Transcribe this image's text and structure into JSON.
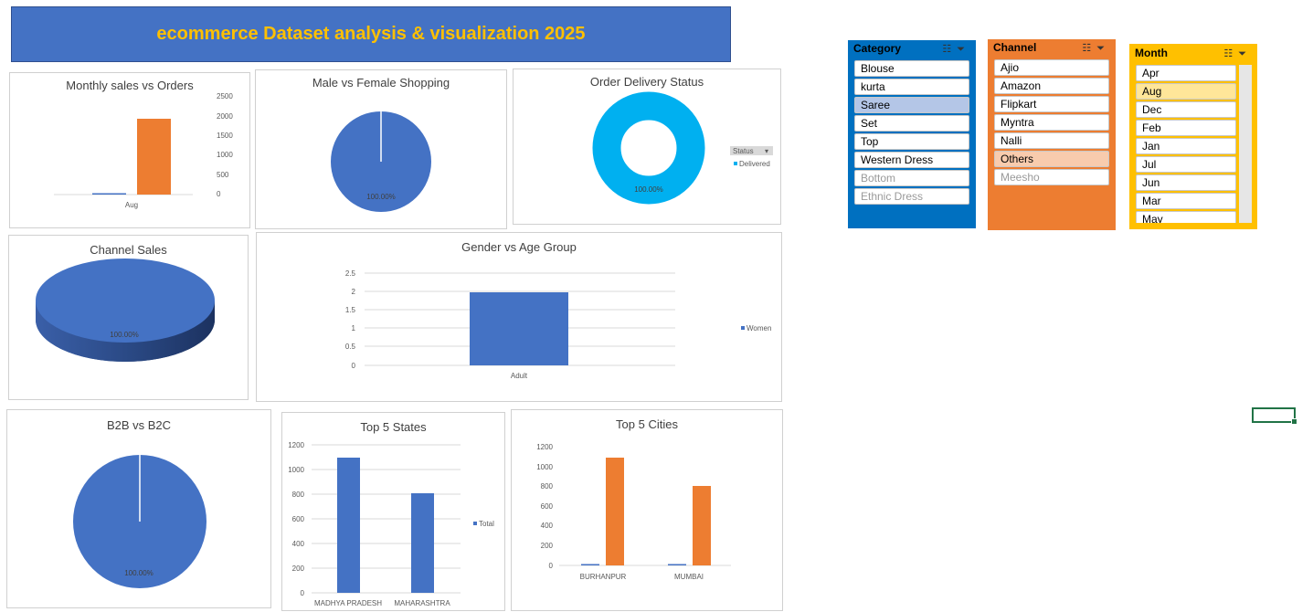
{
  "dashboard": {
    "title": "ecommerce Dataset analysis & visualization 2025"
  },
  "charts": {
    "monthly": {
      "title": "Monthly sales vs Orders",
      "x_label": "Aug",
      "y_ticks": [
        "2500",
        "2000",
        "1500",
        "1000",
        "500",
        "0"
      ]
    },
    "gender": {
      "title": "Male vs Female Shopping",
      "pct": "100.00%"
    },
    "delivery": {
      "title": "Order Delivery Status",
      "pct": "100.00%",
      "legend_filter": "Status",
      "legend_item": "Delivered"
    },
    "channel_sales": {
      "title": "Channel Sales",
      "pct": "100.00%"
    },
    "gender_age": {
      "title": "Gender vs Age Group",
      "y_ticks": [
        "2.5",
        "2",
        "1.5",
        "1",
        "0.5",
        "0"
      ],
      "x_label": "Adult",
      "legend": "Women"
    },
    "b2b": {
      "title": "B2B vs B2C",
      "pct": "100.00%"
    },
    "states": {
      "title": "Top 5 States",
      "y_ticks": [
        "1200",
        "1000",
        "800",
        "600",
        "400",
        "200",
        "0"
      ],
      "x_labels": [
        "MADHYA PRADESH",
        "MAHARASHTRA"
      ],
      "legend": "Total"
    },
    "cities": {
      "title": "Top 5 Cities",
      "y_ticks": [
        "1200",
        "1000",
        "800",
        "600",
        "400",
        "200",
        "0"
      ],
      "x_labels": [
        "BURHANPUR",
        "MUMBAI"
      ]
    }
  },
  "chart_data": [
    {
      "type": "bar",
      "title": "Monthly sales vs Orders",
      "categories": [
        "Aug"
      ],
      "series": [
        {
          "values": [
            12
          ]
        },
        {
          "values": [
            1880
          ]
        }
      ],
      "ylim": [
        0,
        2500
      ],
      "colors": [
        "#4472c4",
        "#ed7d31"
      ]
    },
    {
      "type": "pie",
      "title": "Male vs Female Shopping",
      "values": [
        100
      ],
      "labels": [
        "100.00%"
      ]
    },
    {
      "type": "pie",
      "title": "Order Delivery Status",
      "values": [
        100
      ],
      "labels": [
        "Delivered"
      ]
    },
    {
      "type": "pie",
      "title": "Channel Sales",
      "values": [
        100
      ]
    },
    {
      "type": "bar",
      "title": "Gender vs Age Group",
      "categories": [
        "Adult"
      ],
      "series": [
        {
          "name": "Women",
          "values": [
            2
          ]
        }
      ],
      "ylim": [
        0,
        2.5
      ]
    },
    {
      "type": "pie",
      "title": "B2B vs B2C",
      "values": [
        100
      ]
    },
    {
      "type": "bar",
      "title": "Top 5 States",
      "categories": [
        "MADHYA PRADESH",
        "MAHARASHTRA"
      ],
      "series": [
        {
          "name": "Total",
          "values": [
            1100,
            810
          ]
        }
      ],
      "ylim": [
        0,
        1200
      ]
    },
    {
      "type": "bar",
      "title": "Top 5 Cities",
      "categories": [
        "BURHANPUR",
        "MUMBAI"
      ],
      "series": [
        {
          "values": [
            8,
            8
          ]
        },
        {
          "values": [
            1100,
            810
          ]
        }
      ],
      "ylim": [
        0,
        1200
      ],
      "colors": [
        "#4472c4",
        "#ed7d31"
      ]
    }
  ],
  "slicers": {
    "category": {
      "title": "Category",
      "items": [
        "Blouse",
        "kurta",
        "Saree",
        "Set",
        "Top",
        "Western Dress",
        "Bottom",
        "Ethnic Dress"
      ],
      "selected": "Saree"
    },
    "channel": {
      "title": "Channel",
      "items": [
        "Ajio",
        "Amazon",
        "Flipkart",
        "Myntra",
        "Nalli",
        "Others",
        "Meesho"
      ],
      "selected": "Others"
    },
    "month": {
      "title": "Month",
      "items": [
        "Apr",
        "Aug",
        "Dec",
        "Feb",
        "Jan",
        "Jul",
        "Jun",
        "Mar",
        "May"
      ],
      "selected": "Aug"
    }
  },
  "colors": {
    "blue": "#4472c4",
    "orange": "#ed7d31",
    "cyan": "#00b0f0",
    "gold": "#ffc000"
  }
}
